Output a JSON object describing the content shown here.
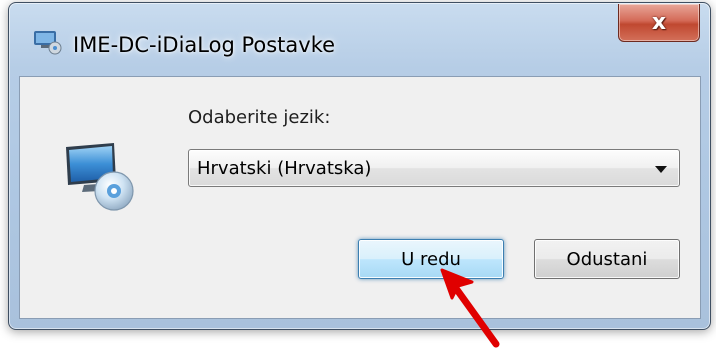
{
  "window": {
    "title": "IME-DC-iDiaLog Postavke",
    "close_label": "x"
  },
  "dialog": {
    "prompt": "Odaberite jezik:",
    "language_select": {
      "selected": "Hrvatski (Hrvatska)"
    },
    "buttons": {
      "ok": "U redu",
      "cancel": "Odustani"
    }
  },
  "icons": {
    "title_icon": "settings-monitor-icon",
    "app_icon": "monitor-disc-icon",
    "dropdown": "chevron-down-icon",
    "annotation": "red-arrow"
  },
  "colors": {
    "titlebar": "#b6cde6",
    "close_button": "#c04830",
    "client_background": "#f0f0f0",
    "ok_button_border": "#3c7fb1",
    "annotation_arrow": "#e00000"
  }
}
